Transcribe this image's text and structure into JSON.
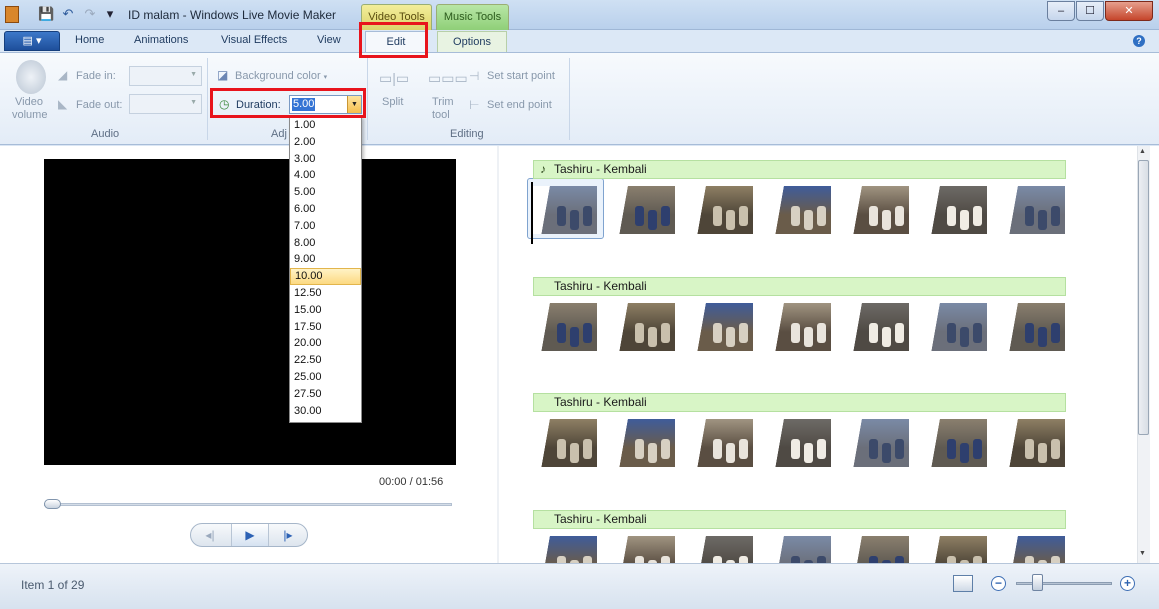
{
  "window": {
    "title": "ID malam - Windows Live Movie Maker",
    "min_glyph": "–",
    "max_glyph": "☐",
    "close_glyph": "✕"
  },
  "quick_access": {
    "save_icon": "💾",
    "undo_icon": "↶",
    "redo_icon": "↷",
    "customize_icon": "▾"
  },
  "context_tabs": {
    "video_tools": "Video Tools",
    "music_tools": "Music Tools"
  },
  "app_menu": {
    "label": "▤ ▾"
  },
  "tabs": {
    "home": "Home",
    "animations": "Animations",
    "visual_effects": "Visual Effects",
    "view": "View",
    "edit": "Edit",
    "options": "Options",
    "active": "Edit"
  },
  "help_glyph": "?",
  "ribbon": {
    "audio": {
      "group_label": "Audio",
      "video_volume_line1": "Video",
      "video_volume_line2": "volume",
      "fade_in_label": "Fade in:",
      "fade_out_label": "Fade out:",
      "fade_in_value": "",
      "fade_out_value": ""
    },
    "adjust": {
      "group_label": "Adj",
      "background_color_label": "Background color",
      "duration_label": "Duration:",
      "duration_value": "5.00"
    },
    "editing": {
      "group_label": "Editing",
      "split_label": "Split",
      "trim_line1": "Trim",
      "trim_line2": "tool",
      "set_start_label": "Set start point",
      "set_end_label": "Set end point"
    }
  },
  "duration_dropdown": {
    "options": [
      "1.00",
      "2.00",
      "3.00",
      "4.00",
      "5.00",
      "6.00",
      "7.00",
      "8.00",
      "9.00",
      "10.00",
      "12.50",
      "15.00",
      "17.50",
      "20.00",
      "22.50",
      "25.00",
      "27.50",
      "30.00"
    ],
    "highlighted": "10.00"
  },
  "preview": {
    "time_current": "00:00",
    "time_separator": "/",
    "time_total": "01:56",
    "prev_frame_glyph": "◂|",
    "play_glyph": "▶",
    "next_frame_glyph": "|▸"
  },
  "storyboard": {
    "music_note_icon": "♪",
    "rows": [
      {
        "music_label": "Tashiru - Kembali",
        "thumb_count": 7
      },
      {
        "music_label": "Tashiru - Kembali",
        "thumb_count": 7
      },
      {
        "music_label": "Tashiru - Kembali",
        "thumb_count": 7
      },
      {
        "music_label": "Tashiru - Kembali",
        "thumb_count": 7
      }
    ]
  },
  "status": {
    "item_text": "Item 1 of 29"
  },
  "zoom": {
    "minus": "−",
    "plus": "+",
    "level": 0.2
  }
}
